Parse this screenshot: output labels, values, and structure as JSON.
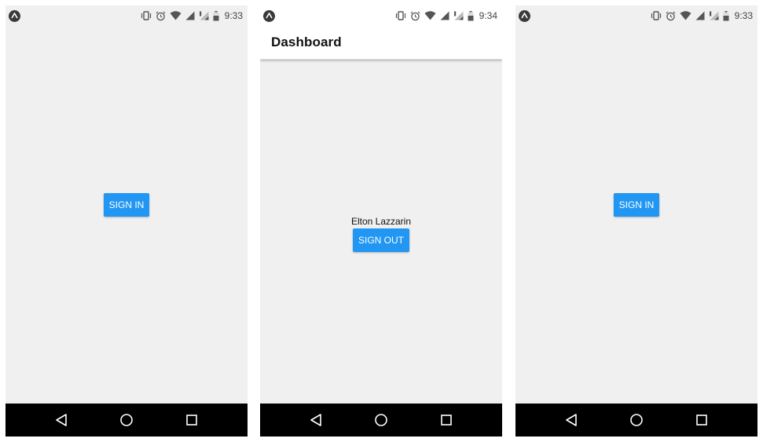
{
  "screens": [
    {
      "status": {
        "time": "9:33"
      },
      "main": {
        "button_label": "SIGN IN"
      }
    },
    {
      "status": {
        "time": "9:34"
      },
      "header": {
        "title": "Dashboard"
      },
      "main": {
        "user_name": "Elton Lazzarin",
        "button_label": "SIGN OUT"
      }
    },
    {
      "status": {
        "time": "9:33"
      },
      "main": {
        "button_label": "SIGN IN"
      }
    }
  ],
  "icons": {
    "status_left": "app-notification-icon",
    "status_right": [
      "vibrate-icon",
      "alarm-icon",
      "wifi-icon",
      "cell-signal-icon",
      "cell-signal-no-data-icon",
      "battery-icon"
    ],
    "nav": [
      "back-icon",
      "home-icon",
      "recents-icon"
    ]
  },
  "colors": {
    "primary_button": "#2196f3",
    "screen_background": "#f0f0f0",
    "nav_bar": "#000000",
    "header_background": "#ffffff"
  }
}
